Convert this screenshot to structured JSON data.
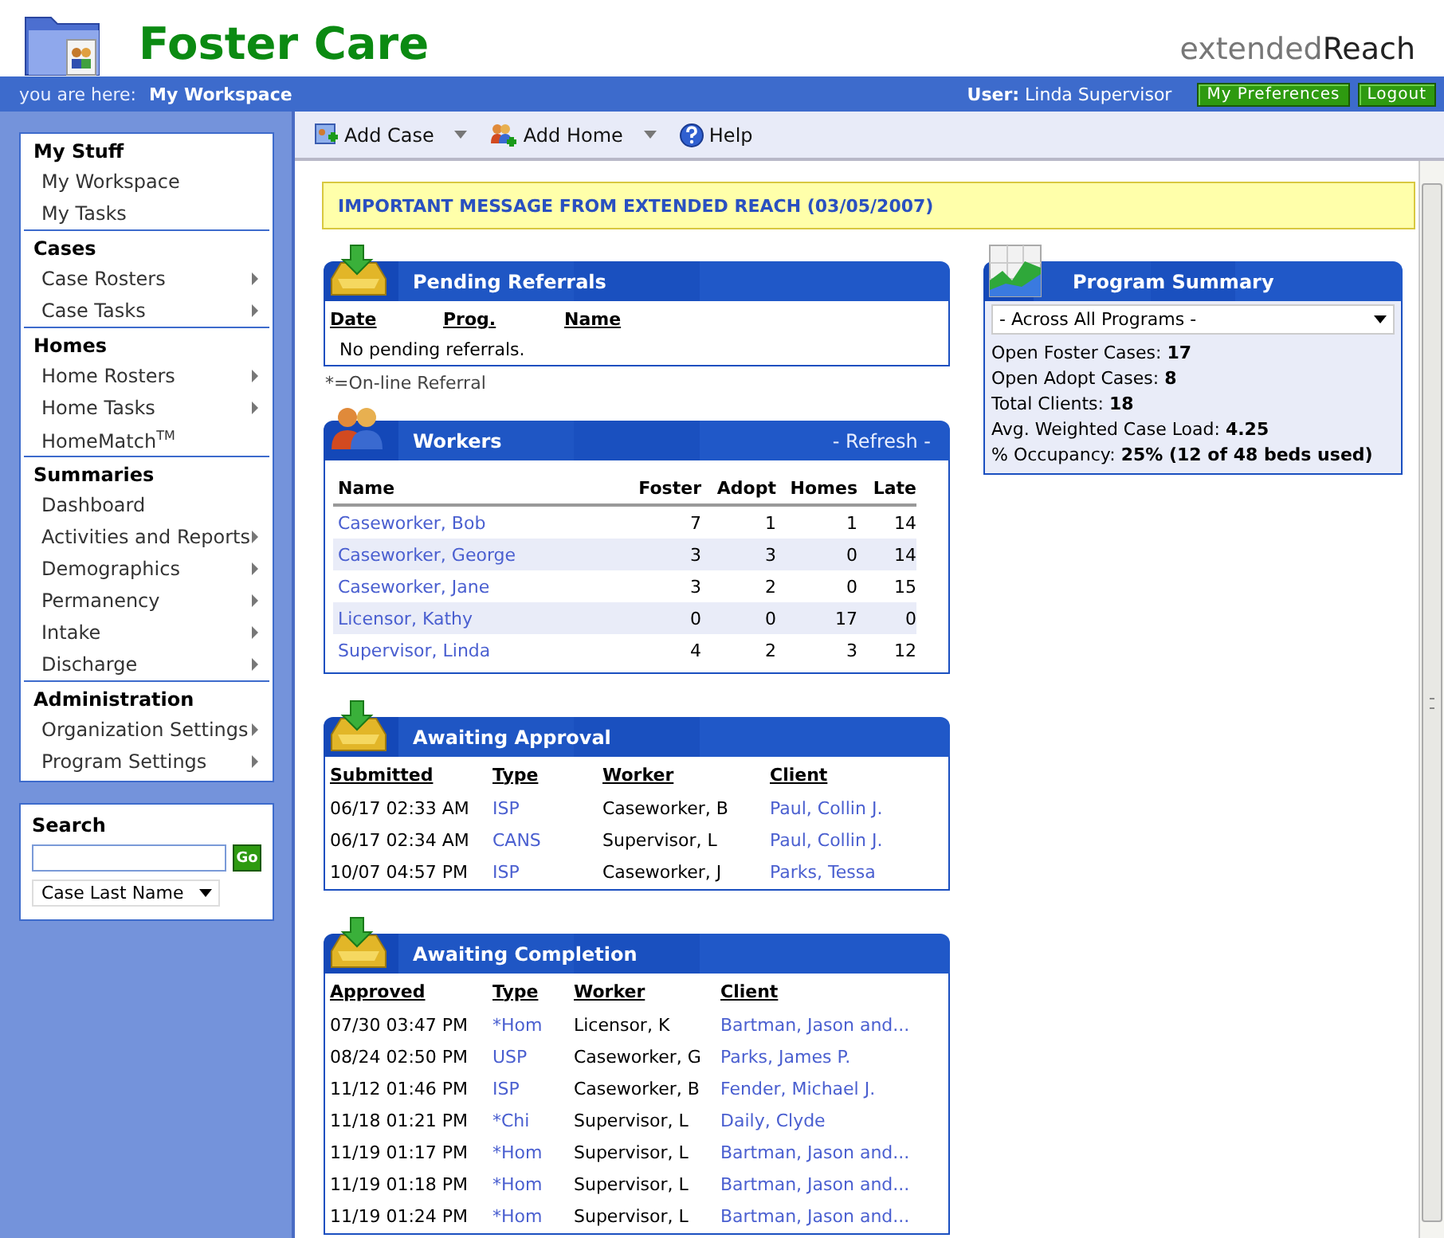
{
  "header": {
    "title": "Foster Care",
    "brand_light": "extended",
    "brand_dark": "Reach",
    "breadcrumb_label": "you are here:",
    "breadcrumb": "My Workspace",
    "user_label": "User:",
    "user": "Linda Supervisor",
    "buttons": [
      "My Preferences",
      "Logout"
    ]
  },
  "sidebar": {
    "sections": [
      {
        "title": "My Stuff",
        "items": [
          {
            "label": "My Workspace",
            "submenu": false
          },
          {
            "label": "My Tasks",
            "submenu": false
          }
        ]
      },
      {
        "title": "Cases",
        "items": [
          {
            "label": "Case Rosters",
            "submenu": true
          },
          {
            "label": "Case Tasks",
            "submenu": true
          }
        ]
      },
      {
        "title": "Homes",
        "items": [
          {
            "label": "Home Rosters",
            "submenu": true
          },
          {
            "label": "Home Tasks",
            "submenu": true
          },
          {
            "label": "HomeMatch$^{TM}$",
            "submenu": false
          }
        ]
      },
      {
        "title": "Summaries",
        "items": [
          {
            "label": "Dashboard",
            "submenu": false
          },
          {
            "label": "Activities and Reports",
            "submenu": true
          },
          {
            "label": "Demographics",
            "submenu": true
          },
          {
            "label": "Permanency",
            "submenu": true
          },
          {
            "label": "Intake",
            "submenu": true
          },
          {
            "label": "Discharge",
            "submenu": true
          }
        ]
      },
      {
        "title": "Administration",
        "items": [
          {
            "label": "Organization Settings",
            "submenu": true
          },
          {
            "label": "Program Settings",
            "submenu": true
          }
        ]
      }
    ]
  },
  "search": {
    "title": "Search",
    "button": "Go",
    "scope": "Case Last Name"
  },
  "toolbar": [
    {
      "kind": "case",
      "label": "Add Case",
      "dropdown": true
    },
    {
      "kind": "home",
      "label": "Add Home",
      "dropdown": true
    },
    {
      "kind": "help",
      "label": "Help",
      "dropdown": false
    }
  ],
  "message": "IMPORTANT MESSAGE FROM EXTENDED REACH (03/05/2007)",
  "pending_referrals": {
    "title": "Pending Referrals",
    "columns": [
      "Date",
      "Prog.",
      "Name"
    ],
    "empty_text": "No pending referrals.",
    "footnote": "*=On-line Referral"
  },
  "workers": {
    "title": "Workers",
    "action": "- Refresh -",
    "columns": [
      "Name",
      "Foster",
      "Adopt",
      "Homes",
      "Late"
    ],
    "rows": [
      {
        "name": "Caseworker, Bob",
        "foster": "7",
        "adopt": "1",
        "homes": "1",
        "late": "14"
      },
      {
        "name": "Caseworker, George",
        "foster": "3",
        "adopt": "3",
        "homes": "0",
        "late": "14"
      },
      {
        "name": "Caseworker, Jane",
        "foster": "3",
        "adopt": "2",
        "homes": "0",
        "late": "15"
      },
      {
        "name": "Licensor, Kathy",
        "foster": "0",
        "adopt": "0",
        "homes": "17",
        "late": "0"
      },
      {
        "name": "Supervisor, Linda",
        "foster": "4",
        "adopt": "2",
        "homes": "3",
        "late": "12"
      }
    ]
  },
  "awaiting_approval": {
    "title": "Awaiting Approval",
    "columns": [
      "Submitted",
      "Type",
      "Worker",
      "Client"
    ],
    "rows": [
      [
        "06/17 02:33 AM",
        "ISP",
        "Caseworker, B",
        "Paul, Collin J."
      ],
      [
        "06/17 02:34 AM",
        "CANS",
        "Supervisor, L",
        "Paul, Collin J."
      ],
      [
        "10/07 04:57 PM",
        "ISP",
        "Caseworker, J",
        "Parks, Tessa"
      ]
    ]
  },
  "awaiting_completion": {
    "title": "Awaiting Completion",
    "columns": [
      "Approved",
      "Type",
      "Worker",
      "Client"
    ],
    "rows": [
      [
        "07/30 03:47 PM",
        "*Hom",
        "Licensor, K",
        "Bartman, Jason and..."
      ],
      [
        "08/24 02:50 PM",
        "USP",
        "Caseworker, G",
        "Parks, James P."
      ],
      [
        "11/12 01:46 PM",
        "ISP",
        "Caseworker, B",
        "Fender, Michael J."
      ],
      [
        "11/18 01:21 PM",
        "*Chi",
        "Supervisor, L",
        "Daily, Clyde"
      ],
      [
        "11/19 01:17 PM",
        "*Hom",
        "Supervisor, L",
        "Bartman, Jason and..."
      ],
      [
        "11/19 01:18 PM",
        "*Hom",
        "Supervisor, L",
        "Bartman, Jason and..."
      ],
      [
        "11/19 01:24 PM",
        "*Hom",
        "Supervisor, L",
        "Bartman, Jason and..."
      ]
    ]
  },
  "program_summary": {
    "title": "Program Summary",
    "program": "- Across All Programs -",
    "stats": [
      {
        "label": "Open Foster Cases:",
        "value": "17"
      },
      {
        "label": "Open Adopt Cases:",
        "value": "8"
      },
      {
        "label": "Total Clients:",
        "value": "18"
      },
      {
        "label": "Avg. Weighted Case Load:",
        "value": "4.25"
      },
      {
        "label": "% Occupancy:",
        "value": "25% (12 of 48 beds used)"
      }
    ]
  }
}
